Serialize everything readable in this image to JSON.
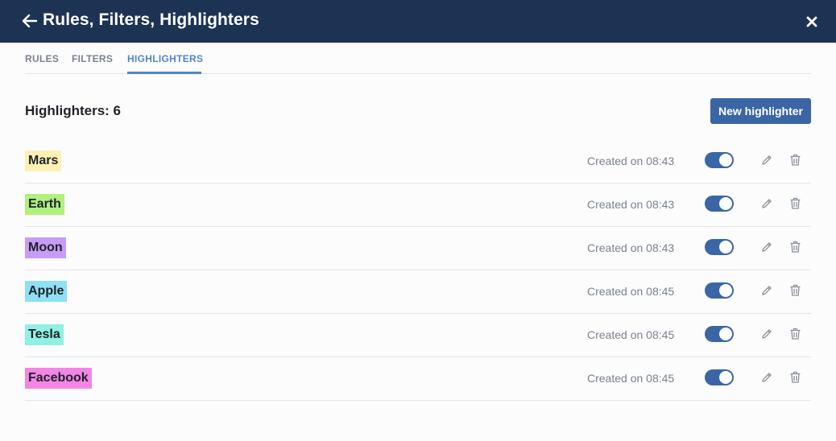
{
  "header": {
    "title": "Rules, Filters, Highlighters",
    "back_icon": "arrow-left-icon",
    "close_icon": "close-icon"
  },
  "tabs": [
    {
      "label": "RULES",
      "active": false
    },
    {
      "label": "FILTERS",
      "active": false
    },
    {
      "label": "HIGHLIGHTERS",
      "active": true
    }
  ],
  "main": {
    "count_title": "Highlighters: 6",
    "new_button_label": "New highlighter"
  },
  "highlighters": [
    {
      "name": "Mars",
      "color": "#fdf0b4",
      "created": "Created on 08:43",
      "enabled": true
    },
    {
      "name": "Earth",
      "color": "#aff07f",
      "created": "Created on 08:43",
      "enabled": true
    },
    {
      "name": "Moon",
      "color": "#c69cf4",
      "created": "Created on 08:43",
      "enabled": true
    },
    {
      "name": "Apple",
      "color": "#8fe0f5",
      "created": "Created on 08:45",
      "enabled": true
    },
    {
      "name": "Tesla",
      "color": "#8ff0e3",
      "created": "Created on 08:45",
      "enabled": true
    },
    {
      "name": "Facebook",
      "color": "#f285e6",
      "created": "Created on 08:45",
      "enabled": true
    }
  ],
  "colors": {
    "header_bg": "#1c3354",
    "accent": "#4f86c7",
    "button_bg": "#3a66a6",
    "muted_text": "#7b828c"
  }
}
